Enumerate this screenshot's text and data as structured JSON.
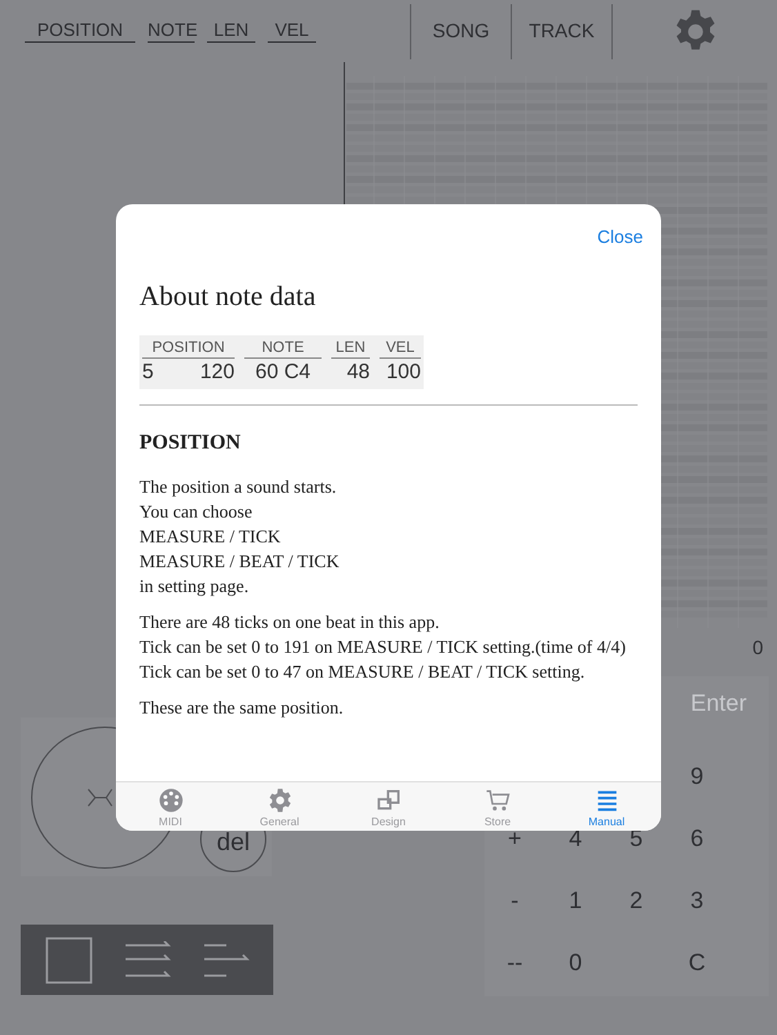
{
  "header": {
    "fields": [
      "POSITION",
      "NOTE",
      "LEN",
      "VEL"
    ],
    "buttons": [
      "SONG",
      "TRACK"
    ]
  },
  "grid_value": "0",
  "joystick": {
    "del_button": "del"
  },
  "keypad": {
    "enter": "Enter",
    "rows": [
      [
        null,
        null,
        null,
        "9"
      ],
      [
        "+",
        "4",
        "5",
        "6"
      ],
      [
        "-",
        "1",
        "2",
        "3"
      ],
      [
        "--",
        "0",
        null,
        "C"
      ]
    ]
  },
  "modal": {
    "close": "Close",
    "title": "About note data",
    "sample": [
      {
        "header": "POSITION",
        "values": [
          "5",
          "120"
        ]
      },
      {
        "header": "NOTE",
        "values": [
          "60 C4"
        ]
      },
      {
        "header": "LEN",
        "values": [
          "48"
        ]
      },
      {
        "header": "VEL",
        "values": [
          "100"
        ]
      }
    ],
    "section": "POSITION",
    "paragraphs": [
      "The position a sound starts.\nYou can choose\nMEASURE / TICK\nMEASURE / BEAT / TICK\nin setting page.",
      "There are 48 ticks on one beat in this app.\nTick can be set 0 to 191 on MEASURE / TICK setting.(time of 4/4)\nTick can be set 0 to 47 on MEASURE / BEAT / TICK setting.",
      "These are the same position."
    ],
    "tabs": [
      {
        "label": "MIDI",
        "kind": "midi",
        "selected": false
      },
      {
        "label": "General",
        "kind": "gear",
        "selected": false
      },
      {
        "label": "Design",
        "kind": "design",
        "selected": false
      },
      {
        "label": "Store",
        "kind": "cart",
        "selected": false
      },
      {
        "label": "Manual",
        "kind": "lines",
        "selected": true
      }
    ]
  }
}
